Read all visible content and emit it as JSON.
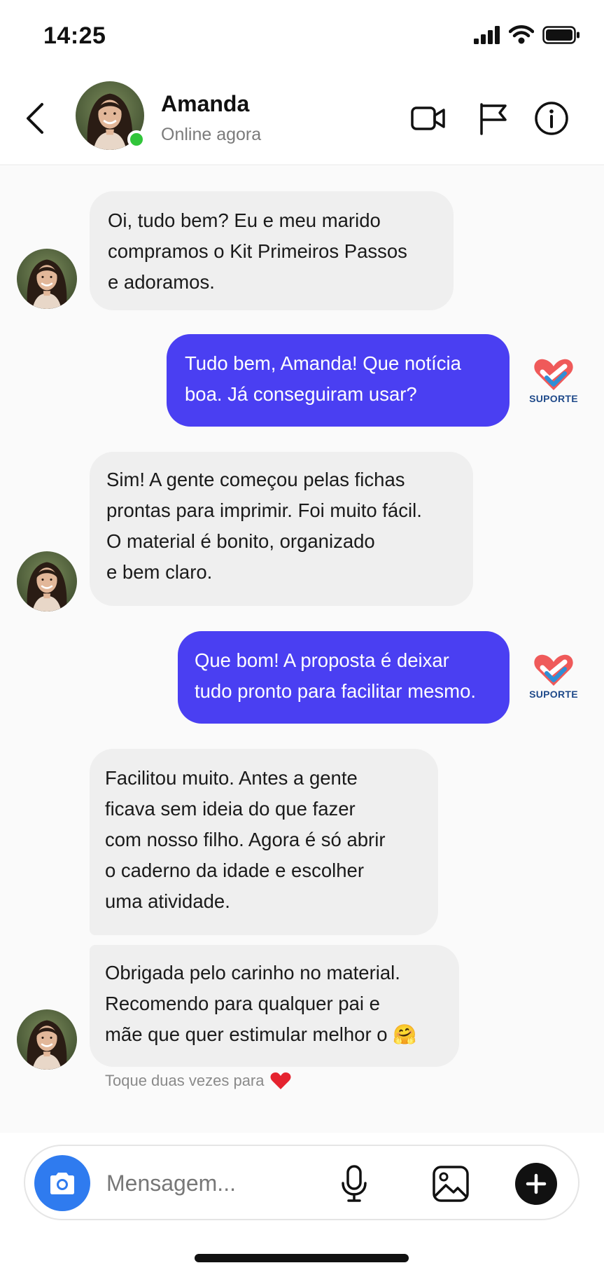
{
  "status_bar": {
    "time": "14:25"
  },
  "header": {
    "contact_name": "Amanda",
    "contact_status": "Online agora"
  },
  "support_label": "SUPORTE",
  "messages": [
    {
      "from": "contact",
      "lines": [
        "Oi, tudo bem? Eu e meu marido",
        "compramos o Kit Primeiros Passos",
        "e adoramos."
      ]
    },
    {
      "from": "support",
      "lines": [
        "Tudo bem, Amanda! Que notícia",
        "boa. Já conseguiram usar?"
      ]
    },
    {
      "from": "contact",
      "lines": [
        "Sim! A gente começou pelas fichas",
        "prontas para imprimir. Foi muito fácil.",
        "O material é bonito, organizado",
        "e bem claro."
      ]
    },
    {
      "from": "support",
      "lines": [
        "Que bom! A proposta é deixar",
        "tudo pronto para facilitar mesmo."
      ]
    },
    {
      "from": "contact",
      "lines": [
        "Facilitou muito. Antes a gente",
        "ficava sem ideia do que fazer",
        "com nosso filho. Agora é só abrir",
        "o caderno da idade e escolher",
        "uma atividade."
      ]
    },
    {
      "from": "contact",
      "lines": [
        "Obrigada pelo carinho no material.",
        "Recomendo para qualquer pai e",
        "mãe que quer estimular melhor o"
      ],
      "emoji": "🤗"
    }
  ],
  "hint": {
    "text": "Toque duas vezes para",
    "emoji": "❤️"
  },
  "composer": {
    "placeholder": "Mensagem..."
  },
  "colors": {
    "outgoing_bubble": "#4a3ff2",
    "incoming_bubble": "#efefef",
    "online_indicator": "#31c53a",
    "camera_button": "#2f7bef"
  },
  "icons": {
    "header": [
      "back-chevron-icon",
      "video-call-icon",
      "flag-icon",
      "info-icon"
    ],
    "composer": [
      "camera-icon",
      "microphone-icon",
      "gallery-icon",
      "plus-icon"
    ],
    "status": [
      "signal-icon",
      "wifi-icon",
      "battery-icon"
    ]
  }
}
